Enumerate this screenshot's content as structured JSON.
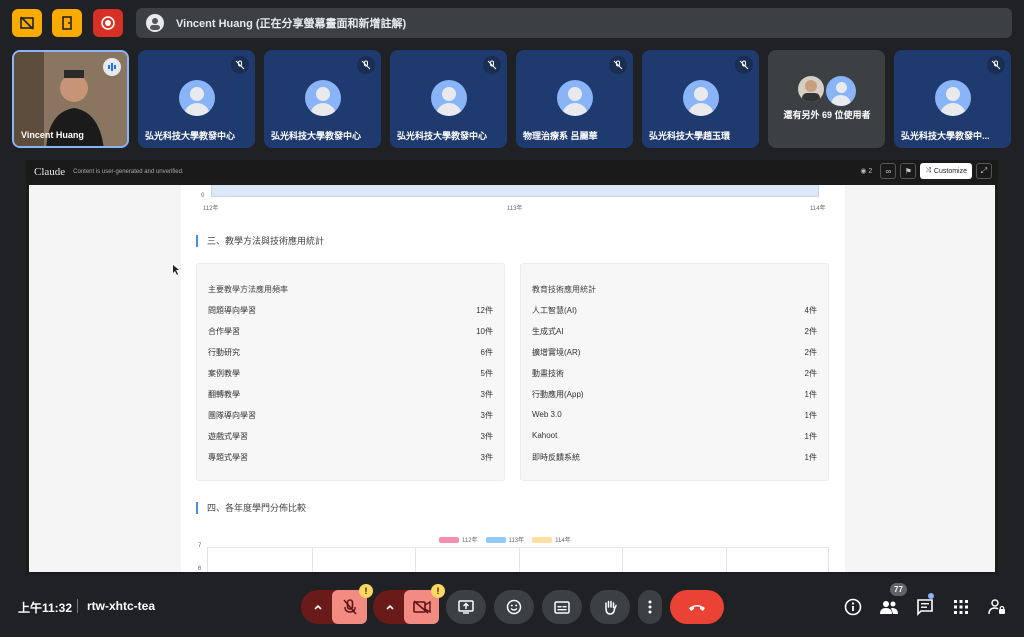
{
  "presenter": {
    "label": "Vincent Huang (正在分享螢幕畫面和新增註解)"
  },
  "participants": [
    {
      "name": "Vincent Huang"
    },
    {
      "name": "弘光科技大學教發中心"
    },
    {
      "name": "弘光科技大學教發中心"
    },
    {
      "name": "弘光科技大學教發中心"
    },
    {
      "name": "物理治療系 呂麗華"
    },
    {
      "name": "弘光科技大學趙玉環"
    },
    {
      "name": "還有另外 69 位使用者"
    },
    {
      "name": "弘光科技大學教發中..."
    }
  ],
  "share": {
    "brand": "Claude",
    "note": "Content is user-generated and unverified.",
    "viewers": "2",
    "customize": "Customize"
  },
  "doc": {
    "top_axis": {
      "zero": "0",
      "years": [
        "112年",
        "113年",
        "114年"
      ]
    },
    "section3": "三、教學方法與技術應用統計",
    "methods": {
      "title": "主要教學方法應用頻率",
      "rows": [
        {
          "label": "問題導向學習",
          "value": "12件"
        },
        {
          "label": "合作學習",
          "value": "10件"
        },
        {
          "label": "行動研究",
          "value": "6件"
        },
        {
          "label": "案例教學",
          "value": "5件"
        },
        {
          "label": "翻轉教學",
          "value": "3件"
        },
        {
          "label": "團隊導向學習",
          "value": "3件"
        },
        {
          "label": "遊戲式學習",
          "value": "3件"
        },
        {
          "label": "專題式學習",
          "value": "3件"
        }
      ]
    },
    "tech": {
      "title": "教育技術應用統計",
      "rows": [
        {
          "label": "人工智慧(AI)",
          "value": "4件"
        },
        {
          "label": "生成式AI",
          "value": "2件"
        },
        {
          "label": "擴增實境(AR)",
          "value": "2件"
        },
        {
          "label": "動畫技術",
          "value": "2件"
        },
        {
          "label": "行動應用(App)",
          "value": "1件"
        },
        {
          "label": "Web 3.0",
          "value": "1件"
        },
        {
          "label": "Kahoot",
          "value": "1件"
        },
        {
          "label": "即時反饋系統",
          "value": "1件"
        }
      ]
    },
    "section4": "四、各年度學門分佈比較",
    "legend": [
      {
        "name": "112年",
        "color": "#f48fb1"
      },
      {
        "name": "113年",
        "color": "#90caf9"
      },
      {
        "name": "114年",
        "color": "#ffe0a3"
      }
    ],
    "y_ticks": [
      "7",
      "6"
    ]
  },
  "bottom": {
    "time": "上午11:32",
    "code": "rtw-xhtc-tea",
    "participants_count": "77",
    "warn_mark": "!"
  }
}
